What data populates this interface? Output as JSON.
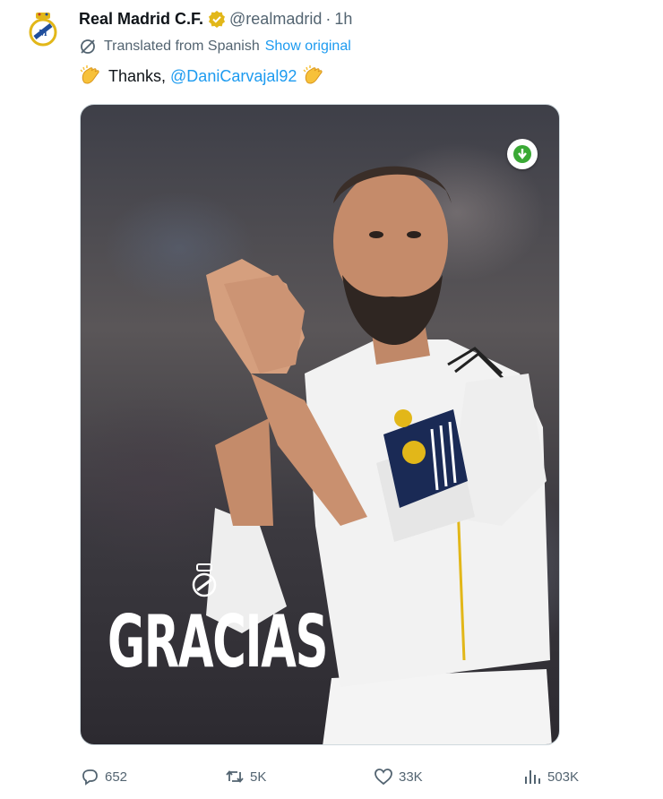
{
  "tweet": {
    "author_name": "Real Madrid C.F.",
    "handle": "@realmadrid",
    "separator": "·",
    "time": "1h",
    "translated_label": "Translated from Spanish",
    "show_original": "Show original",
    "text_prefix": "Thanks,",
    "mention": "@DaniCarvajal92",
    "media_text": "GRACIAS"
  },
  "actions": {
    "replies": "652",
    "retweets": "5K",
    "likes": "33K",
    "views": "503K"
  },
  "icons": {
    "verified": "verified-badge-icon",
    "translate": "globe-translate-icon",
    "clap": "clapping-hands-emoji",
    "download": "download-arrow-icon",
    "reply": "reply-icon",
    "retweet": "retweet-icon",
    "like": "heart-icon",
    "views": "views-chart-icon"
  },
  "colors": {
    "accent": "#1d9bf0",
    "verified_gold": "#e2b719",
    "secondary_text": "#536471",
    "download_green": "#3aa935"
  }
}
